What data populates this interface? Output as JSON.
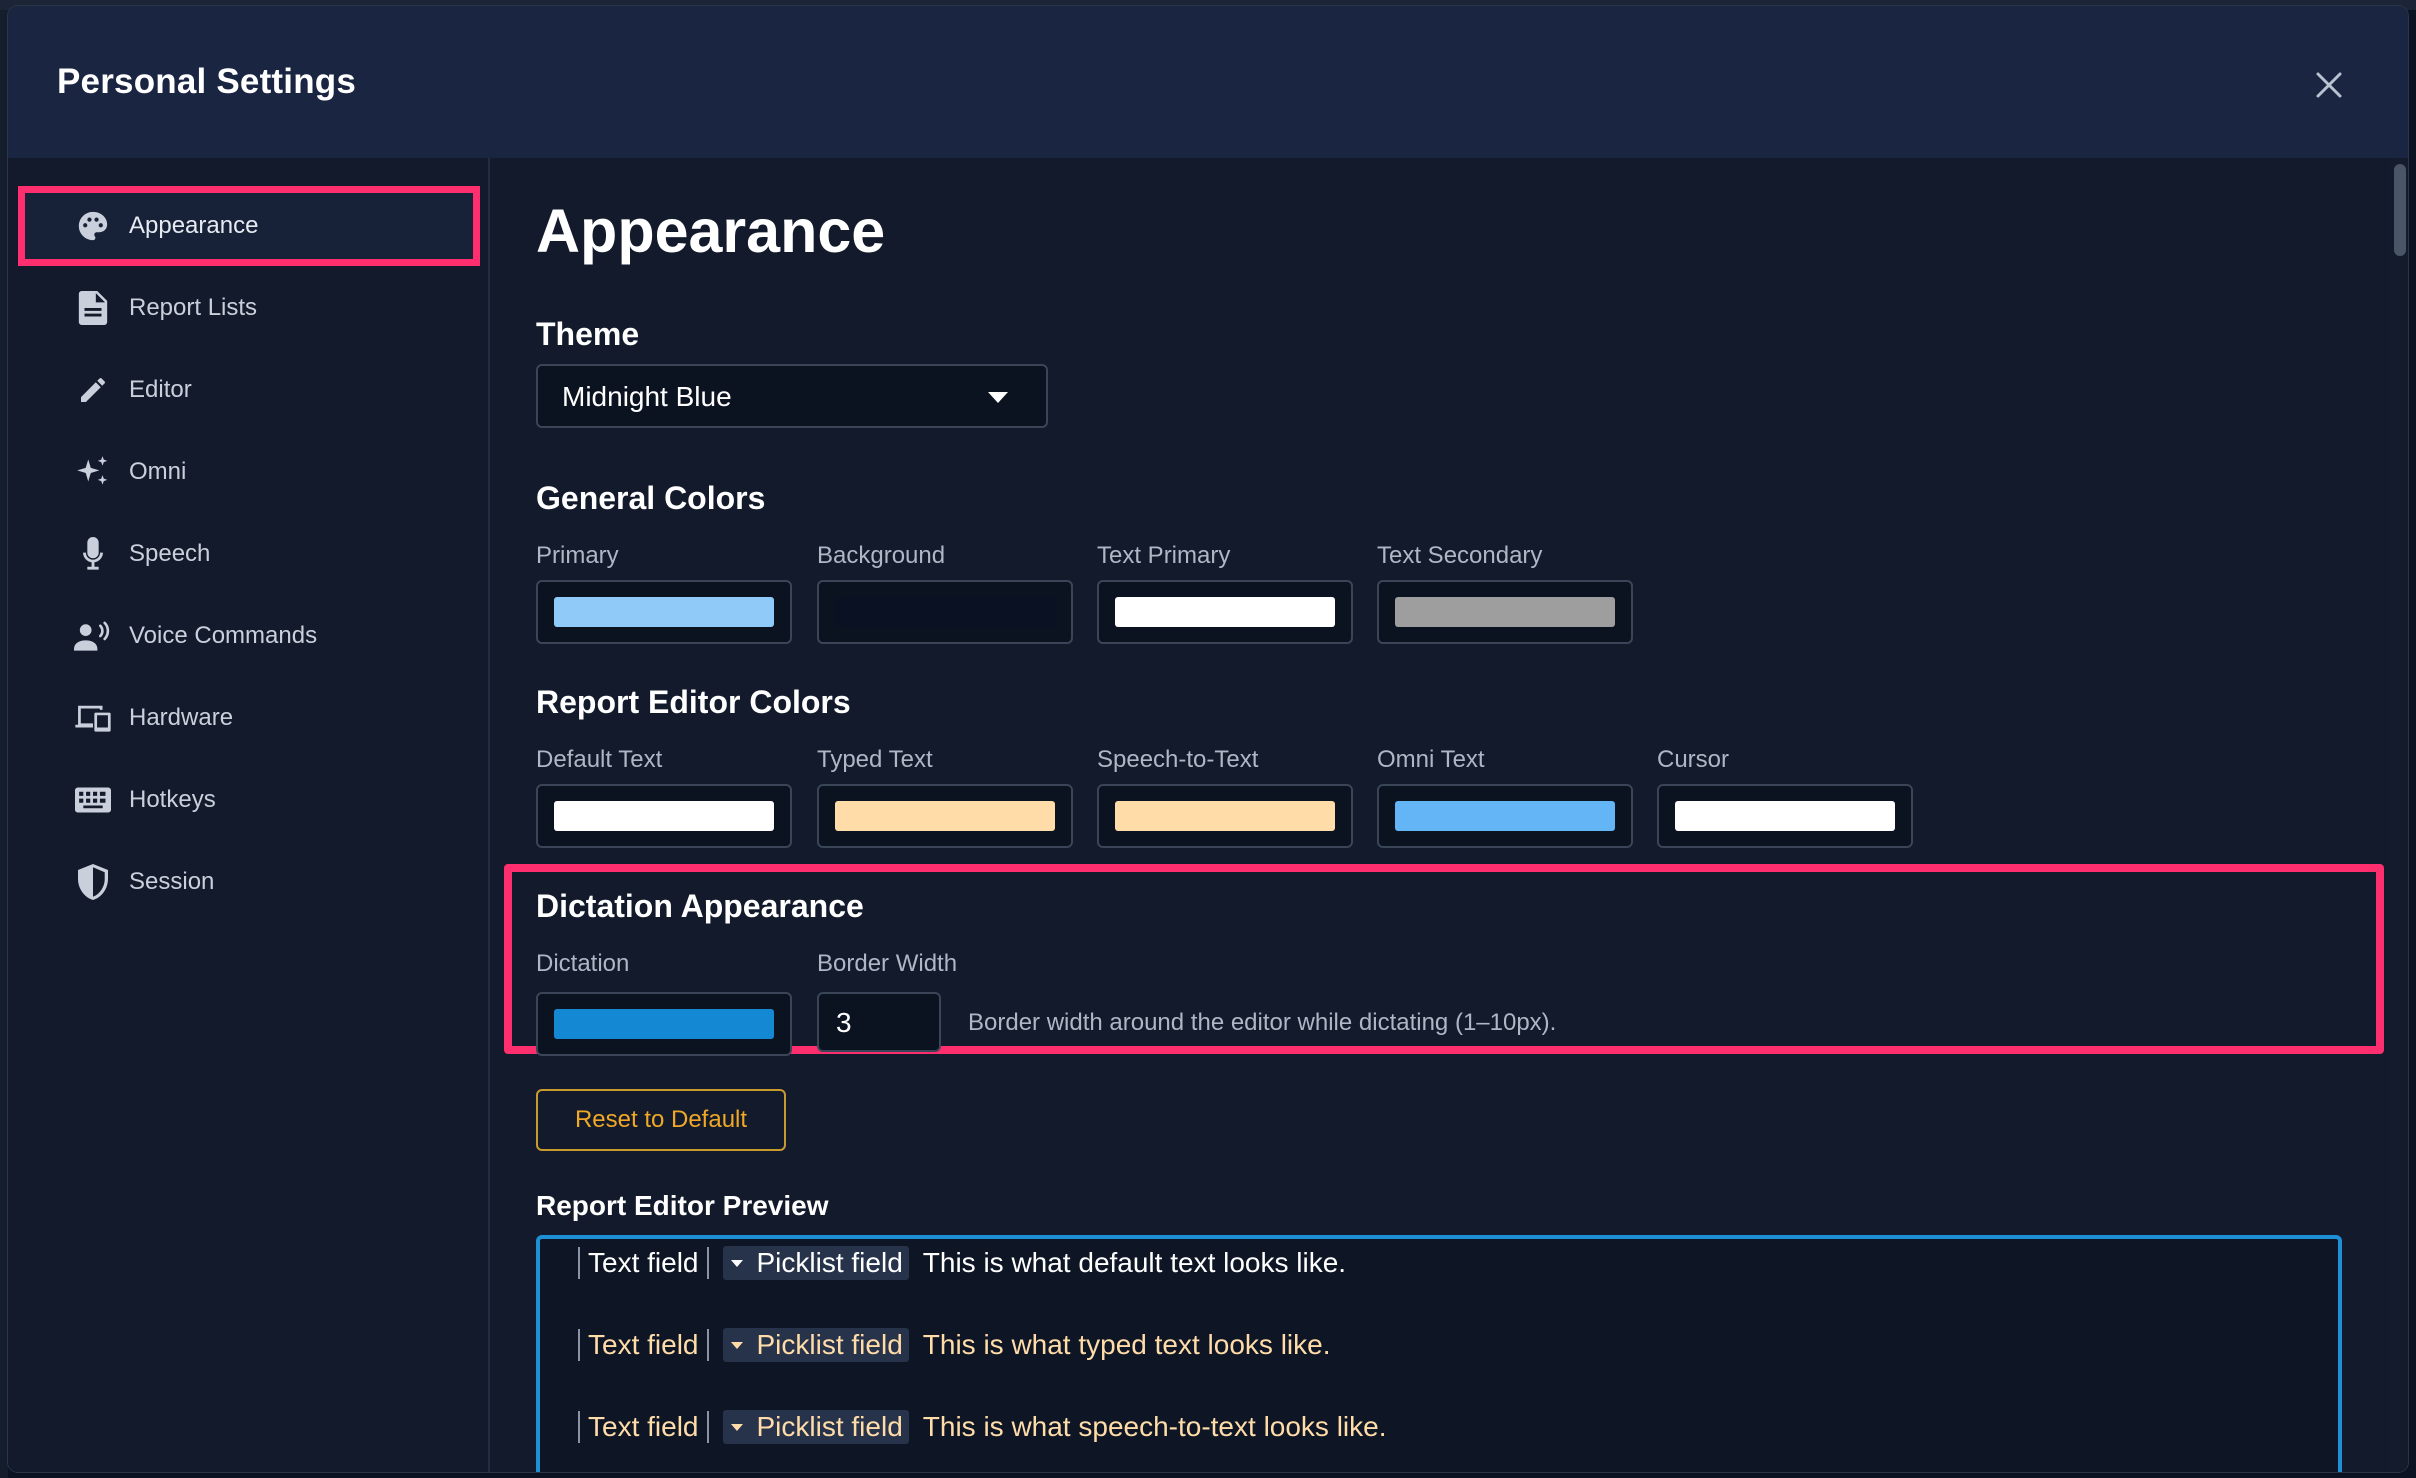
{
  "window": {
    "title": "Personal Settings",
    "close_label": "Close"
  },
  "sidebar": {
    "items": [
      {
        "label": "Appearance",
        "icon": "palette-icon",
        "active": true
      },
      {
        "label": "Report Lists",
        "icon": "document-icon"
      },
      {
        "label": "Editor",
        "icon": "pencil-icon"
      },
      {
        "label": "Omni",
        "icon": "sparkles-icon"
      },
      {
        "label": "Speech",
        "icon": "microphone-icon"
      },
      {
        "label": "Voice Commands",
        "icon": "voice-user-icon"
      },
      {
        "label": "Hardware",
        "icon": "devices-icon"
      },
      {
        "label": "Hotkeys",
        "icon": "keyboard-icon"
      },
      {
        "label": "Session",
        "icon": "shield-icon"
      }
    ]
  },
  "main": {
    "title": "Appearance",
    "theme": {
      "label": "Theme",
      "value": "Midnight Blue"
    },
    "general_colors": {
      "label": "General Colors",
      "items": [
        {
          "label": "Primary",
          "color": "#90caf9"
        },
        {
          "label": "Background",
          "color": "#0a1122"
        },
        {
          "label": "Text Primary",
          "color": "#ffffff"
        },
        {
          "label": "Text Secondary",
          "color": "#9e9e9e"
        }
      ]
    },
    "editor_colors": {
      "label": "Report Editor Colors",
      "items": [
        {
          "label": "Default Text",
          "color": "#ffffff"
        },
        {
          "label": "Typed Text",
          "color": "#ffdca8"
        },
        {
          "label": "Speech-to-Text",
          "color": "#ffdca8"
        },
        {
          "label": "Omni Text",
          "color": "#64b5f6"
        },
        {
          "label": "Cursor",
          "color": "#ffffff"
        }
      ]
    },
    "dictation": {
      "label": "Dictation Appearance",
      "dictation_label": "Dictation",
      "dictation_color": "#1488d2",
      "border_width_label": "Border Width",
      "border_width_value": "3",
      "hint": "Border width around the editor while dictating (1–10px)."
    },
    "reset_label": "Reset to Default",
    "preview": {
      "label": "Report Editor Preview",
      "text_field": "Text field",
      "picklist_field": "Picklist field",
      "lines": [
        {
          "text": "This is what default text looks like.",
          "color": "#ffffff"
        },
        {
          "text": "This is what typed text looks like.",
          "color": "#ffdca8"
        },
        {
          "text": "This is what speech-to-text looks like.",
          "color": "#ffdca8"
        }
      ]
    }
  },
  "colors": {
    "accent_highlight": "#ff2e6e",
    "reset_button": "#f0a826",
    "preview_border": "#1e90d6"
  }
}
